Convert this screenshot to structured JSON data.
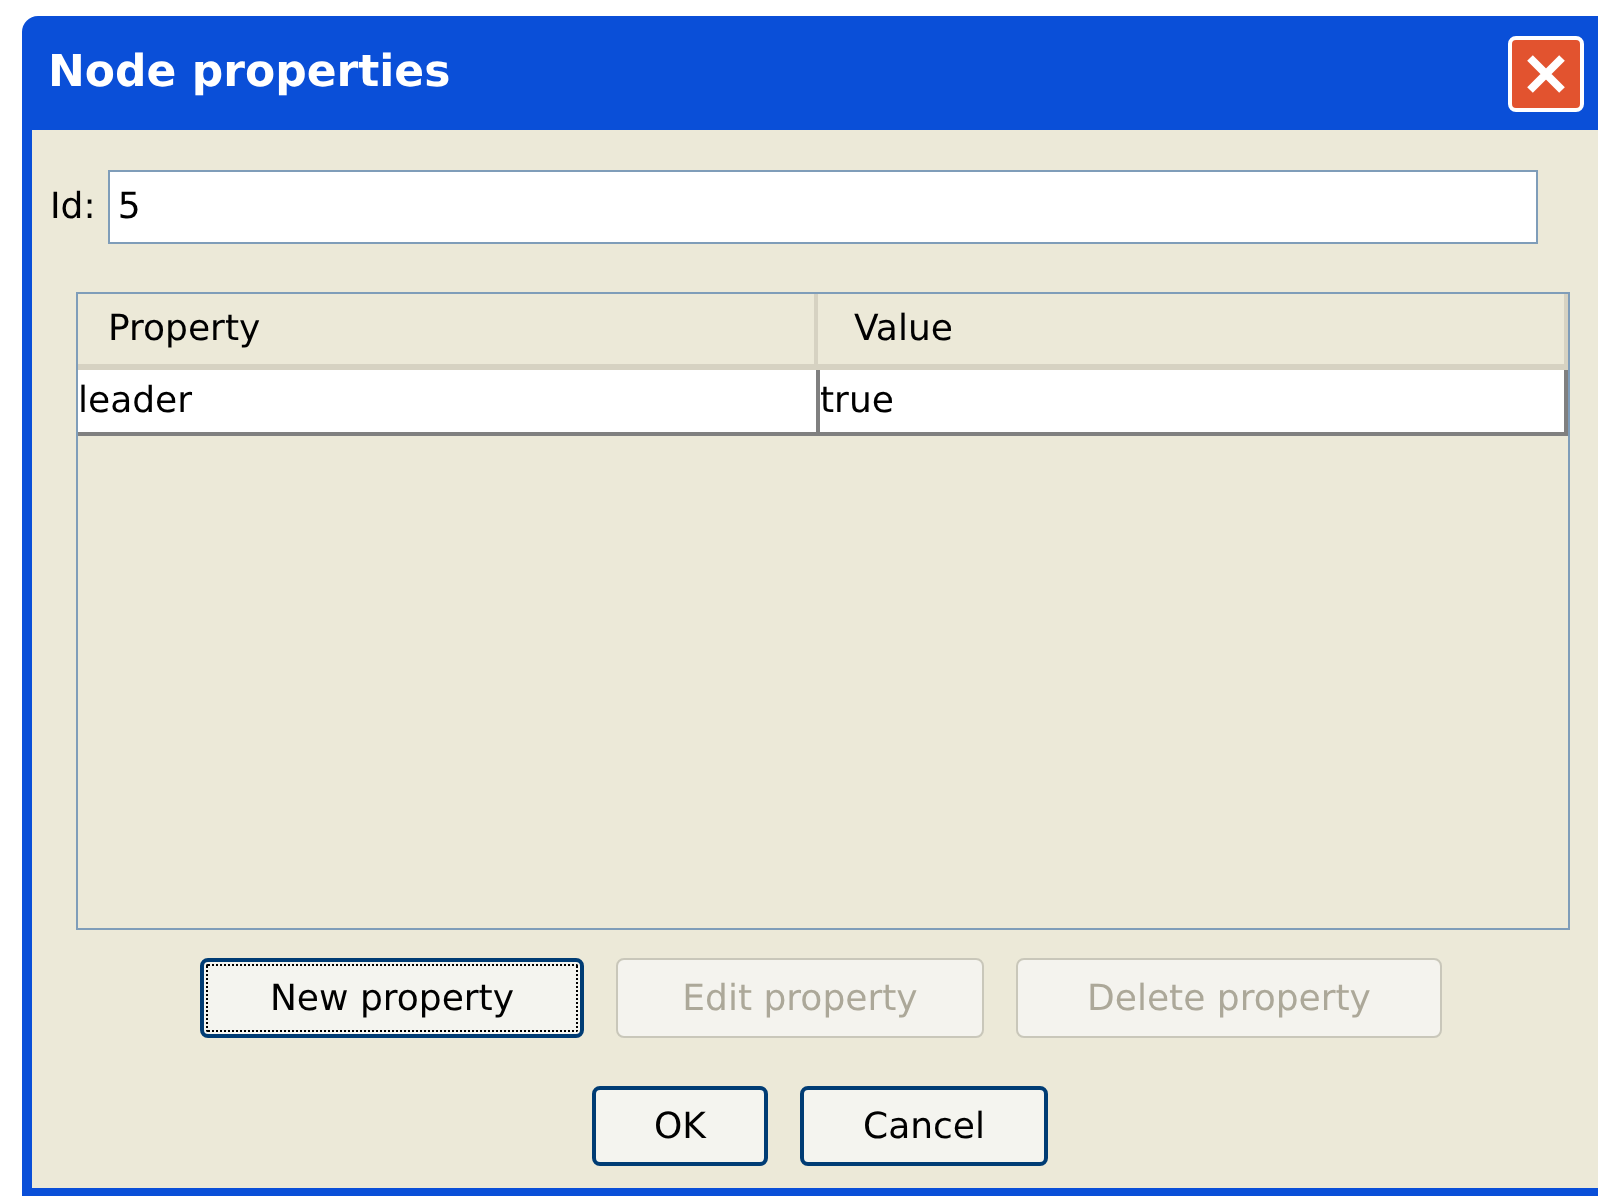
{
  "window": {
    "title": "Node properties"
  },
  "id_field": {
    "label": "Id:",
    "value": "5"
  },
  "table": {
    "columns": [
      "Property",
      "Value"
    ],
    "rows": [
      {
        "cells": [
          "leader",
          "true"
        ]
      }
    ]
  },
  "action_buttons": [
    {
      "label": "New property",
      "disabled": false,
      "focused": true
    },
    {
      "label": "Edit property",
      "disabled": true,
      "focused": false
    },
    {
      "label": "Delete property",
      "disabled": true,
      "focused": false
    }
  ],
  "dialog_buttons": [
    {
      "label": "OK"
    },
    {
      "label": "Cancel"
    }
  ]
}
